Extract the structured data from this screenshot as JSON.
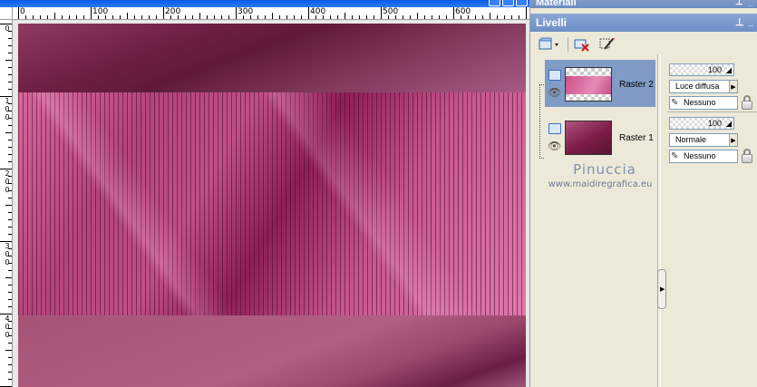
{
  "canvas": {
    "ruler_h_labels": [
      "0",
      "100",
      "200",
      "300",
      "400",
      "500",
      "600"
    ],
    "ruler_v_labels": [
      "0",
      "1\n0\n0",
      "2\n0\n0",
      "3\n0\n0",
      "4\n0\n0"
    ]
  },
  "materiali_panel": {
    "title": "Materiali"
  },
  "livelli_panel": {
    "title": "Livelli",
    "layers": [
      {
        "name": "Raster 2",
        "selected": true,
        "opacity": "100",
        "blend_mode": "Luce diffusa",
        "mask": "Nessuno"
      },
      {
        "name": "Raster 1",
        "selected": false,
        "opacity": "100",
        "blend_mode": "Normale",
        "mask": "Nessuno"
      }
    ]
  },
  "watermark": {
    "name": "Pinuccia",
    "url": "www.maidiregrafica.eu"
  },
  "colors": {
    "accent_blue": "#7f9bc6",
    "magenta_dark": "#601a3b",
    "magenta_light": "#e07aab"
  }
}
